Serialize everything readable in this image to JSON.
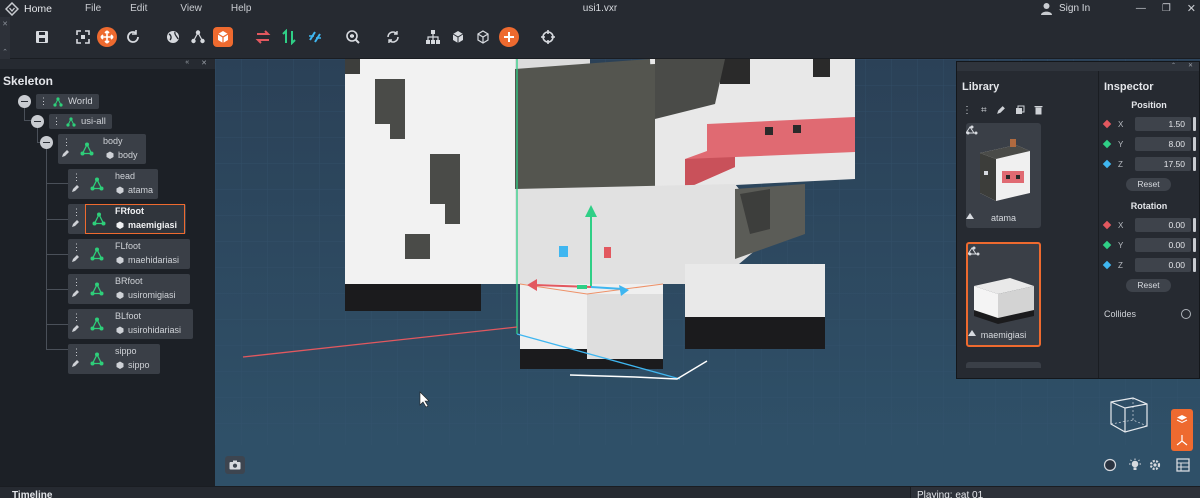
{
  "menubar": {
    "home": "Home",
    "items": [
      "File",
      "Edit",
      "View",
      "Help"
    ],
    "title": "usi1.vxr",
    "signin": "Sign In"
  },
  "toolbar": {
    "icons": [
      "save-icon",
      "fit-view-icon",
      "move-tool-icon",
      "rotate-tool-icon",
      "globe-icon",
      "pivot-icon",
      "voxel-box-icon",
      "swap-horizontal-icon",
      "swap-vertical-icon",
      "mirror-icon",
      "search-3d-icon",
      "refresh-icon",
      "hierarchy-icon",
      "cube-solid-icon",
      "cube-outline-icon",
      "add-icon",
      "target-icon"
    ]
  },
  "skeleton": {
    "title": "Skeleton",
    "world": "World",
    "root": "usi-all",
    "body": {
      "name": "body",
      "mesh": "body"
    },
    "children": [
      {
        "name": "head",
        "mesh": "atama"
      },
      {
        "name": "FRfoot",
        "mesh": "maemigiasi",
        "selected": true
      },
      {
        "name": "FLfoot",
        "mesh": "maehidariasi"
      },
      {
        "name": "BRfoot",
        "mesh": "usiromigiasi"
      },
      {
        "name": "BLfoot",
        "mesh": "usirohidariasi"
      },
      {
        "name": "sippo",
        "mesh": "sippo"
      }
    ]
  },
  "library": {
    "title": "Library",
    "items": [
      {
        "label": "atama"
      },
      {
        "label": "maemigiasi",
        "selected": true
      }
    ]
  },
  "inspector": {
    "title": "Inspector",
    "position": {
      "title": "Position",
      "x": "1.50",
      "y": "8.00",
      "z": "17.50",
      "reset": "Reset"
    },
    "rotation": {
      "title": "Rotation",
      "x": "0.00",
      "y": "0.00",
      "z": "0.00",
      "reset": "Reset"
    },
    "collides": "Collides"
  },
  "timeline": {
    "title": "Timeline",
    "playing": "Playing: eat 01"
  },
  "colors": {
    "accent": "#ee6a2f",
    "node_green": "#2ecf7a",
    "axis_x": "#e2585f",
    "axis_y": "#2fcf86",
    "axis_z": "#3fb6f0"
  }
}
